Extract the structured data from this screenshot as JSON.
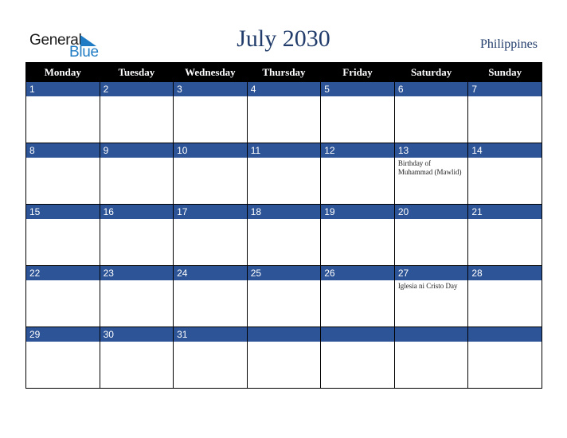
{
  "logo": {
    "word1": "General",
    "word2": "Blue"
  },
  "header": {
    "title": "July 2030",
    "country": "Philippines"
  },
  "weekdays": [
    "Monday",
    "Tuesday",
    "Wednesday",
    "Thursday",
    "Friday",
    "Saturday",
    "Sunday"
  ],
  "weeks": [
    [
      {
        "day": "1",
        "event": ""
      },
      {
        "day": "2",
        "event": ""
      },
      {
        "day": "3",
        "event": ""
      },
      {
        "day": "4",
        "event": ""
      },
      {
        "day": "5",
        "event": ""
      },
      {
        "day": "6",
        "event": ""
      },
      {
        "day": "7",
        "event": ""
      }
    ],
    [
      {
        "day": "8",
        "event": ""
      },
      {
        "day": "9",
        "event": ""
      },
      {
        "day": "10",
        "event": ""
      },
      {
        "day": "11",
        "event": ""
      },
      {
        "day": "12",
        "event": ""
      },
      {
        "day": "13",
        "event": "Birthday of Muhammad (Mawlid)"
      },
      {
        "day": "14",
        "event": ""
      }
    ],
    [
      {
        "day": "15",
        "event": ""
      },
      {
        "day": "16",
        "event": ""
      },
      {
        "day": "17",
        "event": ""
      },
      {
        "day": "18",
        "event": ""
      },
      {
        "day": "19",
        "event": ""
      },
      {
        "day": "20",
        "event": ""
      },
      {
        "day": "21",
        "event": ""
      }
    ],
    [
      {
        "day": "22",
        "event": ""
      },
      {
        "day": "23",
        "event": ""
      },
      {
        "day": "24",
        "event": ""
      },
      {
        "day": "25",
        "event": ""
      },
      {
        "day": "26",
        "event": ""
      },
      {
        "day": "27",
        "event": "Iglesia ni Cristo Day"
      },
      {
        "day": "28",
        "event": ""
      }
    ],
    [
      {
        "day": "29",
        "event": ""
      },
      {
        "day": "30",
        "event": ""
      },
      {
        "day": "31",
        "event": ""
      },
      {
        "day": "",
        "event": ""
      },
      {
        "day": "",
        "event": ""
      },
      {
        "day": "",
        "event": ""
      },
      {
        "day": "",
        "event": ""
      }
    ]
  ],
  "colors": {
    "day_bar": "#2d5496",
    "header_bg": "#000000",
    "title": "#223d6b",
    "logo_blue": "#1f7cc4"
  }
}
